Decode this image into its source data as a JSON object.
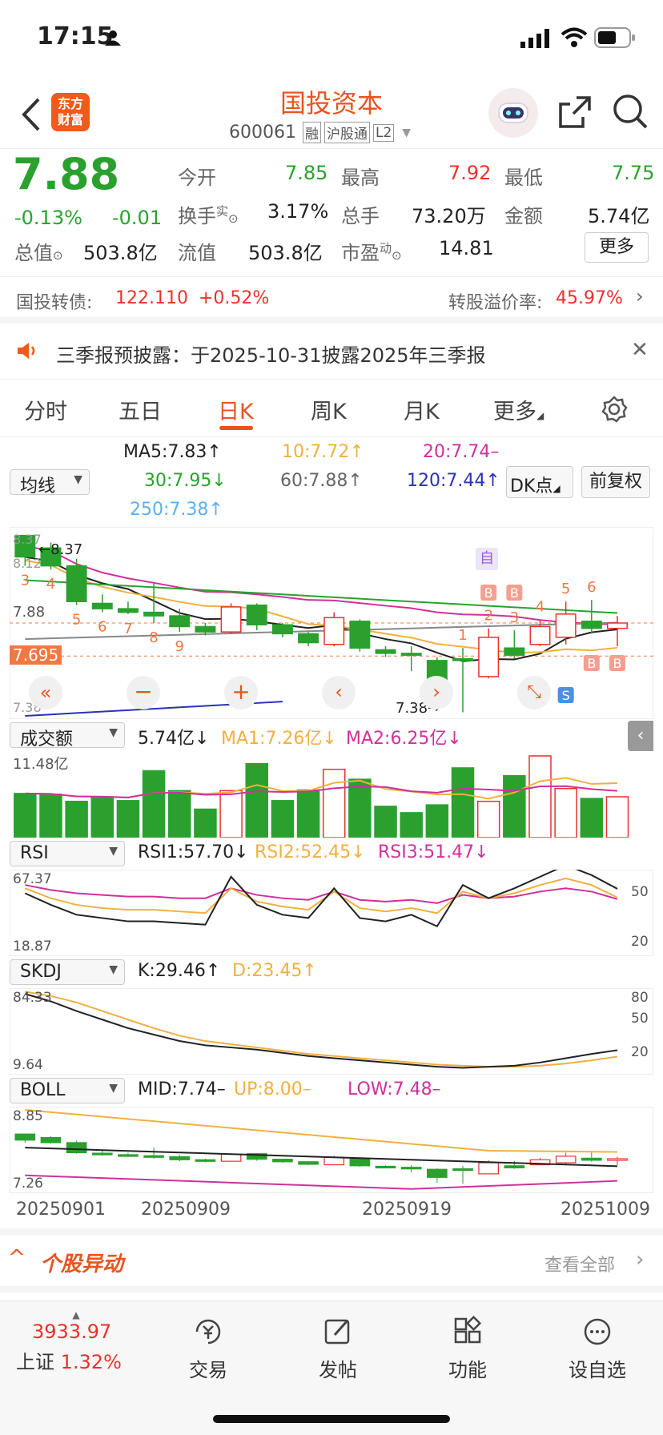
{
  "status_bar": {
    "time": "17:15"
  },
  "header": {
    "logo_line1": "东方",
    "logo_line2": "财富",
    "title": "国投资本",
    "code": "600061",
    "badges": [
      "融",
      "沪股通",
      "L2"
    ]
  },
  "quote": {
    "price": "7.88",
    "change_pct": "-0.13%",
    "change": "-0.01",
    "open_label": "今开",
    "open": "7.85",
    "high_label": "最高",
    "high": "7.92",
    "low_label": "最低",
    "low": "7.75",
    "turnover_label": "换手",
    "turnover_sup": "实",
    "turnover": "3.17%",
    "volume_label": "总手",
    "volume": "73.20万",
    "amount_label": "金额",
    "amount": "5.74亿",
    "mcap_label": "总值",
    "mcap": "503.8亿",
    "float_label": "流值",
    "float": "503.8亿",
    "pe_label": "市盈",
    "pe_sup": "动",
    "pe": "14.81",
    "more_label": "更多"
  },
  "convertible": {
    "name": "国投转债:",
    "price": "122.110",
    "change": "+0.52%",
    "premium_label": "转股溢价率:",
    "premium": "45.97%"
  },
  "notice": {
    "text": "三季报预披露：于2025-10-31披露2025年三季报"
  },
  "tabs": [
    "分时",
    "五日",
    "日K",
    "周K",
    "月K",
    "更多"
  ],
  "active_tab": "日K",
  "ma": {
    "selector": "均线",
    "ma5": "MA5:7.83↑",
    "ma10": "10:7.72↑",
    "ma20": "20:7.74–",
    "ma30": "30:7.95↓",
    "ma60": "60:7.88↑",
    "ma120": "120:7.44↑",
    "ma250": "250:7.38↑",
    "dk_label": "DK点",
    "adj_label": "前复权"
  },
  "kline": {
    "y_top": "8.37",
    "y_mid": "8.12",
    "y_cur": "7.88",
    "y_marker": "7.695",
    "y_bot": "7.38",
    "high_label": "8.37",
    "low_label": "7.38",
    "self_tag": "自",
    "num_tags": [
      "3",
      "4",
      "5",
      "6",
      "7",
      "8",
      "9",
      "1",
      "2",
      "3",
      "4",
      "5",
      "6"
    ],
    "bs_tags": [
      "B",
      "B",
      "B",
      "B",
      "S"
    ]
  },
  "volume": {
    "selector": "成交额",
    "value": "5.74亿↓",
    "ma1": "MA1:7.26亿↓",
    "ma2": "MA2:6.25亿↓",
    "y_max": "11.48亿"
  },
  "rsi": {
    "selector": "RSI",
    "rsi1": "RSI1:57.70↓",
    "rsi2": "RSI2:52.45↓",
    "rsi3": "RSI3:51.47↓",
    "y_top": "67.37",
    "y_bot": "18.87",
    "r50": "50",
    "r20": "20"
  },
  "skdj": {
    "selector": "SKDJ",
    "k": "K:29.46↑",
    "d": "D:23.45↑",
    "y_top": "84.33",
    "y_bot": "9.64",
    "r80": "80",
    "r50": "50",
    "r20": "20"
  },
  "boll": {
    "selector": "BOLL",
    "mid": "MID:7.74–",
    "up": "UP:8.00–",
    "low": "LOW:7.48–",
    "y_top": "8.85",
    "y_bot": "7.26"
  },
  "dates": [
    "20250901",
    "20250909",
    "20250919",
    "20251009"
  ],
  "movers": {
    "title": "个股异动",
    "view_all": "查看全部"
  },
  "bottom_nav": {
    "index_value": "3933.97",
    "index_name": "上证",
    "index_change": "1.32%",
    "items": [
      "交易",
      "发帖",
      "功能",
      "设自选"
    ]
  },
  "chart_data": {
    "type": "candlestick",
    "dates": [
      "20250901",
      "20250909",
      "20250919",
      "20251009"
    ],
    "ohlc": [
      [
        8.37,
        8.37,
        8.2,
        8.25
      ],
      [
        8.3,
        8.33,
        8.18,
        8.2
      ],
      [
        8.2,
        8.24,
        7.98,
        8.0
      ],
      [
        7.99,
        8.04,
        7.94,
        7.96
      ],
      [
        7.96,
        8.0,
        7.93,
        7.94
      ],
      [
        7.94,
        8.1,
        7.88,
        7.92
      ],
      [
        7.92,
        7.96,
        7.83,
        7.86
      ],
      [
        7.86,
        7.88,
        7.81,
        7.83
      ],
      [
        7.83,
        7.99,
        7.82,
        7.97
      ],
      [
        7.98,
        7.99,
        7.84,
        7.87
      ],
      [
        7.87,
        7.88,
        7.8,
        7.82
      ],
      [
        7.82,
        7.83,
        7.75,
        7.77
      ],
      [
        7.76,
        7.94,
        7.75,
        7.91
      ],
      [
        7.89,
        7.9,
        7.72,
        7.74
      ],
      [
        7.73,
        7.75,
        7.69,
        7.71
      ],
      [
        7.71,
        7.75,
        7.61,
        7.7
      ],
      [
        7.67,
        7.69,
        7.4,
        7.51
      ],
      [
        7.68,
        7.74,
        7.38,
        7.67
      ],
      [
        7.58,
        7.85,
        7.57,
        7.8
      ],
      [
        7.74,
        7.84,
        7.68,
        7.7
      ],
      [
        7.76,
        7.9,
        7.75,
        7.86
      ],
      [
        7.8,
        8.0,
        7.76,
        7.93
      ],
      [
        7.89,
        8.01,
        7.82,
        7.85
      ],
      [
        7.85,
        7.92,
        7.75,
        7.88
      ]
    ],
    "volume_yi": [
      6.2,
      6.1,
      5.1,
      5.6,
      5.2,
      9.4,
      6.6,
      4.0,
      6.6,
      10.4,
      5.2,
      6.7,
      9.6,
      8.2,
      4.4,
      3.5,
      4.6,
      9.8,
      5.1,
      8.7,
      11.48,
      6.9,
      5.5,
      5.74
    ]
  }
}
